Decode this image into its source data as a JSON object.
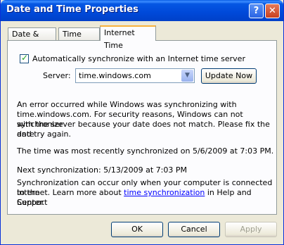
{
  "window": {
    "title": "Date and Time Properties",
    "help_label": "?",
    "close_label": "✕"
  },
  "tabs": [
    {
      "label": "Date & Time"
    },
    {
      "label": "Time Zone"
    },
    {
      "label": "Internet Time"
    }
  ],
  "auto_sync": {
    "checked": true,
    "label": "Automatically synchronize with an Internet time server"
  },
  "server": {
    "label": "Server:",
    "value": "time.windows.com",
    "update_label": "Update Now"
  },
  "error": {
    "line1": "An error occurred while Windows was synchronizing with",
    "line2": "time.windows.com.  For security reasons, Windows can not synchronize",
    "line3": "with the server because your date does not match.  Please fix the date",
    "line4": "and try again."
  },
  "last_sync": "The time was most recently synchronized on 5/6/2009 at 7:03 PM.",
  "next_sync": "Next synchronization: 5/13/2009 at 7:03 PM",
  "info": {
    "line1": "Synchronization can occur only when your computer is connected to the",
    "line2_before": "Internet.  Learn more about ",
    "link": "time synchronization",
    "line2_after": " in Help and Support",
    "line3": "Center."
  },
  "buttons": {
    "ok": "OK",
    "cancel": "Cancel",
    "apply": "Apply"
  }
}
